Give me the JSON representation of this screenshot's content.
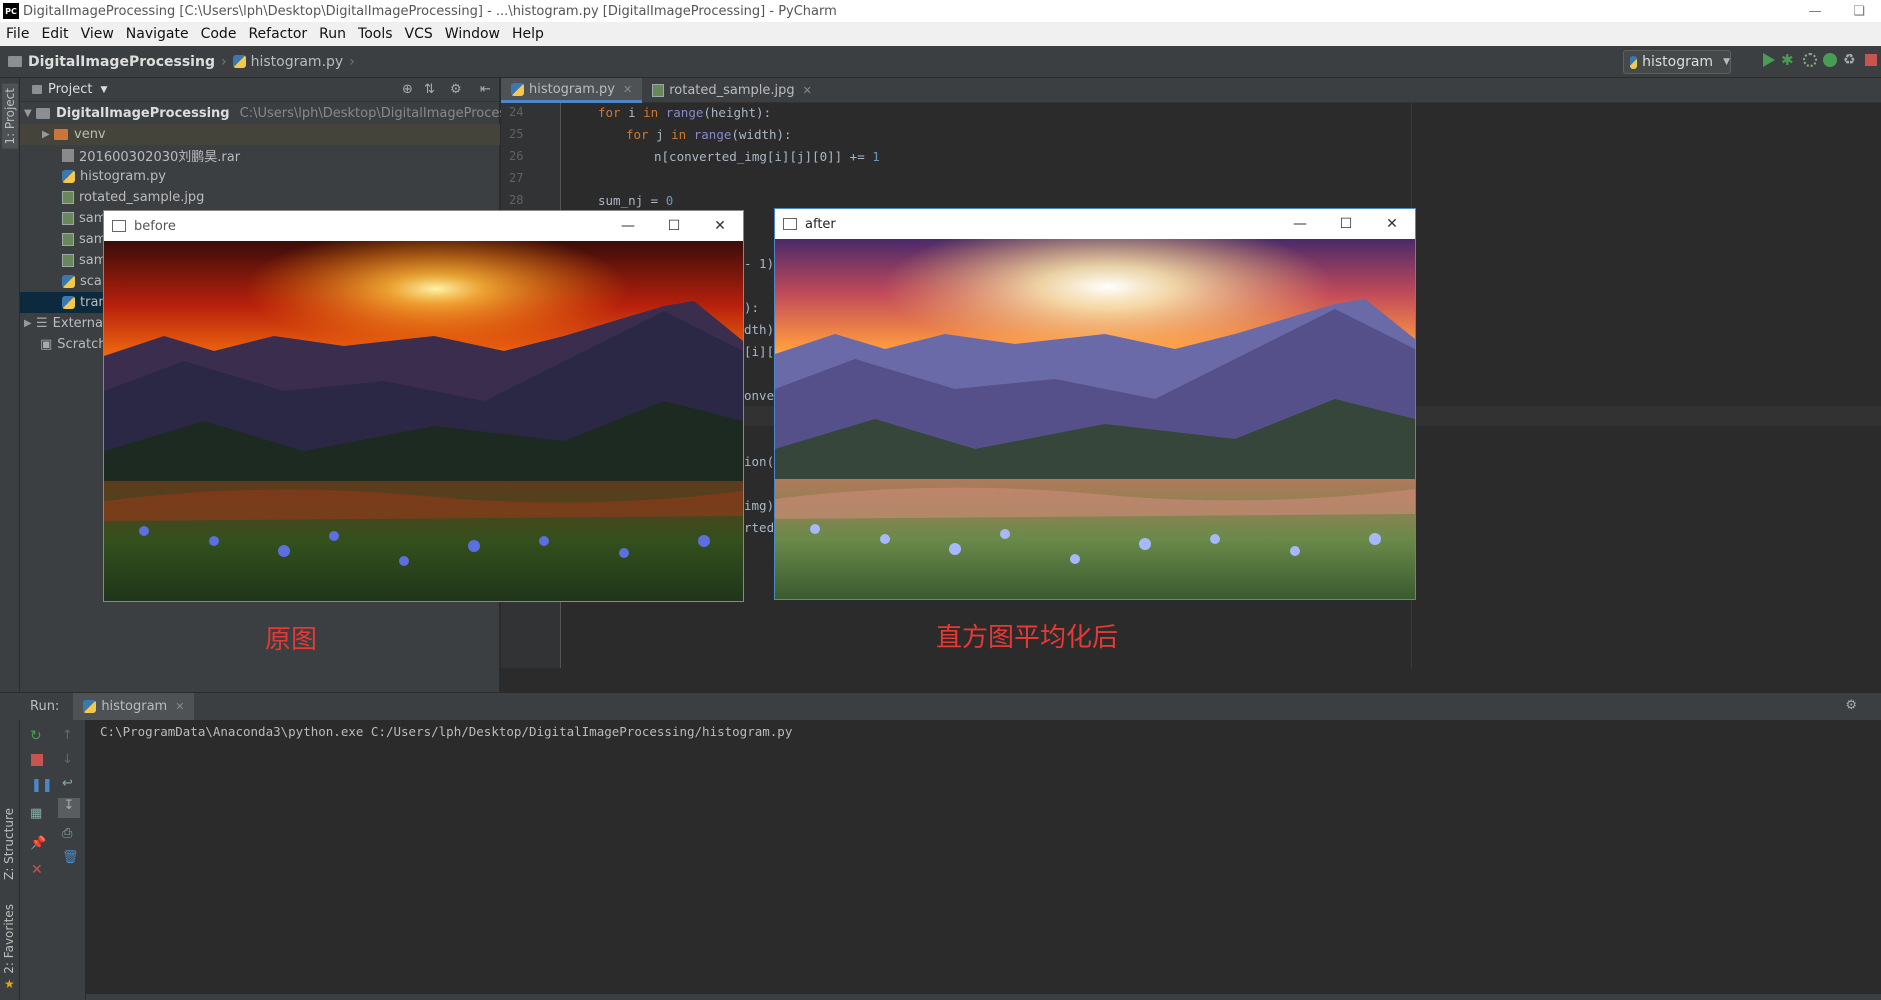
{
  "window": {
    "title": "DigitalImageProcessing [C:\\Users\\lph\\Desktop\\DigitalImageProcessing] - ...\\histogram.py [DigitalImageProcessing] - PyCharm",
    "logo": "PC"
  },
  "menu": [
    "File",
    "Edit",
    "View",
    "Navigate",
    "Code",
    "Refactor",
    "Run",
    "Tools",
    "VCS",
    "Window",
    "Help"
  ],
  "breadcrumb": {
    "project": "DigitalImageProcessing",
    "file": "histogram.py"
  },
  "run_config": {
    "name": "histogram"
  },
  "left_tabs": {
    "project": "1: Project",
    "structure": "Z: Structure",
    "favorites": "2: Favorites"
  },
  "project_panel": {
    "title": "Project",
    "root": {
      "name": "DigitalImageProcessing",
      "path": "C:\\Users\\lph\\Desktop\\DigitalImageProcessing"
    },
    "items": [
      {
        "name": "venv",
        "type": "folder"
      },
      {
        "name": "201600302030刘鹏昊.rar",
        "type": "rar"
      },
      {
        "name": "histogram.py",
        "type": "py"
      },
      {
        "name": "rotated_sample.jpg",
        "type": "img"
      },
      {
        "name": "sam",
        "type": "img"
      },
      {
        "name": "sam",
        "type": "img"
      },
      {
        "name": "sam",
        "type": "img"
      },
      {
        "name": "scale",
        "type": "py"
      },
      {
        "name": "tran",
        "type": "py"
      },
      {
        "name": "Externa",
        "type": "lib"
      },
      {
        "name": "Scratch",
        "type": "scratch"
      }
    ]
  },
  "editor": {
    "tabs": [
      {
        "label": "histogram.py",
        "active": true
      },
      {
        "label": "rotated_sample.jpg",
        "active": false
      }
    ],
    "line_numbers": [
      "24",
      "25",
      "26",
      "27",
      "28"
    ],
    "code_lines": {
      "l24_kw": "for",
      "l24_var": " i ",
      "l24_in": "in",
      "l24_fn": " range",
      "l24_rest": "(height):",
      "l25_kw": "for",
      "l25_var": " j ",
      "l25_in": "in",
      "l25_fn": " range",
      "l25_rest": "(width):",
      "l26_a": "n[converted_img[i][j][0]] += ",
      "l26_num": "1",
      "l28_a": "sum_nj = ",
      "l28_num": "0"
    },
    "partial_code": [
      "- 1)",
      "):",
      "dth):",
      "[i][",
      "onve",
      "ion(",
      "img)",
      "rted"
    ]
  },
  "cv_windows": {
    "before": {
      "title": "before"
    },
    "after": {
      "title": "after"
    }
  },
  "captions": {
    "before": "原图",
    "after": "直方图平均化后"
  },
  "run_panel": {
    "label": "Run:",
    "tab": "histogram",
    "console_line": "C:\\ProgramData\\Anaconda3\\python.exe C:/Users/lph/Desktop/DigitalImageProcessing/histogram.py"
  },
  "colors": {
    "accent": "#4a88c7",
    "caption_red": "#e53935",
    "run_green": "#499c54",
    "stop_red": "#c75450"
  }
}
